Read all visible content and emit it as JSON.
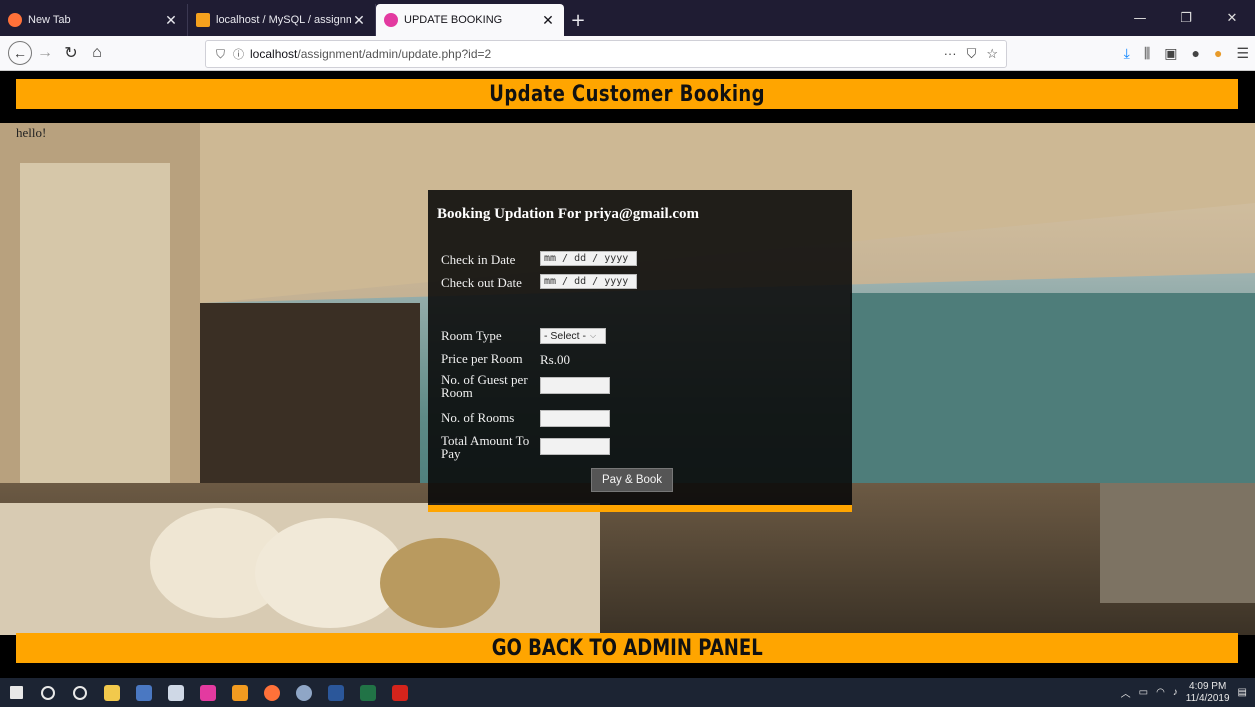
{
  "browser": {
    "tabs": [
      {
        "title": "New Tab",
        "favicon_color": "#ff7139",
        "active": false
      },
      {
        "title": "localhost / MySQL / assignmen",
        "favicon_color": "#f4a11e",
        "active": false
      },
      {
        "title": "UPDATE BOOKING",
        "favicon_color": "#e33aa0",
        "active": true
      }
    ],
    "new_tab_symbol": "+",
    "url_host": "localhost",
    "url_path": "/assignment/admin/update.php?id=2"
  },
  "page": {
    "header": "Update Customer Booking",
    "hello_text": "hello!",
    "footer": "GO BACK TO ADMIN PANEL",
    "accent_color": "#ffa500"
  },
  "form": {
    "title": "Booking Updation For priya@gmail.com",
    "check_in_label": "Check in Date",
    "check_in_placeholder": "mm / dd / yyyy",
    "check_out_label": "Check out Date",
    "check_out_placeholder": "mm / dd / yyyy",
    "room_type_label": "Room Type",
    "room_type_selected": "- Select -",
    "price_label": "Price per Room",
    "price_value": "Rs.00",
    "guests_label": "No. of Guest per Room",
    "rooms_label": "No. of Rooms",
    "total_label": "Total Amount To Pay",
    "submit_label": "Pay & Book"
  },
  "taskbar": {
    "time": "4:09 PM",
    "date": "11/4/2019"
  }
}
